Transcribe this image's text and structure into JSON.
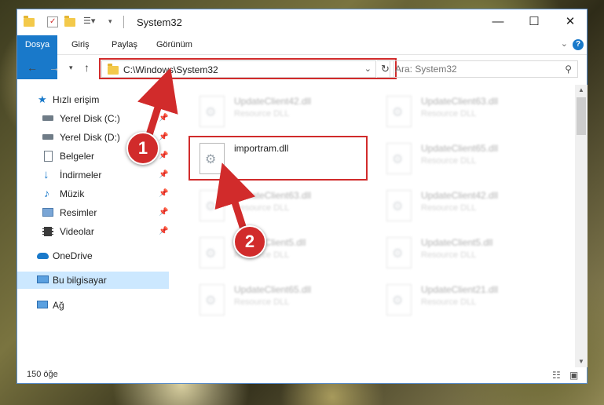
{
  "window": {
    "title": "System32",
    "controls": {
      "minimize": "—",
      "maximize": "☐",
      "close": "✕"
    }
  },
  "ribbon": {
    "tabs": [
      "Dosya",
      "Giriş",
      "Paylaş",
      "Görünüm"
    ],
    "help": "?"
  },
  "navigation": {
    "address": "C:\\Windows\\System32",
    "search_placeholder": "Ara: System32"
  },
  "sidebar": {
    "items": [
      {
        "label": "Hızlı erişim",
        "icon": "star-icon",
        "pinned": false
      },
      {
        "label": "Yerel Disk (C:)",
        "icon": "drive-icon",
        "pinned": true
      },
      {
        "label": "Yerel Disk (D:)",
        "icon": "drive-icon",
        "pinned": true
      },
      {
        "label": "Belgeler",
        "icon": "document-icon",
        "pinned": true
      },
      {
        "label": "İndirmeler",
        "icon": "download-icon",
        "pinned": true
      },
      {
        "label": "Müzik",
        "icon": "music-icon",
        "pinned": true
      },
      {
        "label": "Resimler",
        "icon": "pictures-icon",
        "pinned": true
      },
      {
        "label": "Videolar",
        "icon": "video-icon",
        "pinned": true
      },
      {
        "label": "OneDrive",
        "icon": "cloud-icon",
        "pinned": false
      },
      {
        "label": "Bu bilgisayar",
        "icon": "computer-icon",
        "pinned": false
      },
      {
        "label": "Ağ",
        "icon": "network-icon",
        "pinned": false
      }
    ]
  },
  "files": [
    {
      "name": "UpdateClient42.dll",
      "type": "Resource DLL"
    },
    {
      "name": "UpdateClient63.dll",
      "type": "Resource DLL"
    },
    {
      "name": "importram.dll",
      "type": ""
    },
    {
      "name": "UpdateClient65.dll",
      "type": "Resource DLL"
    },
    {
      "name": "UpdateClient63.dll",
      "type": "Resource DLL"
    },
    {
      "name": "UpdateClient42.dll",
      "type": "Resource DLL"
    },
    {
      "name": "UpdateClient5.dll",
      "type": "Resource DLL"
    },
    {
      "name": "UpdateClient5.dll",
      "type": "Resource DLL"
    },
    {
      "name": "UpdateClient65.dll",
      "type": "Resource DLL"
    },
    {
      "name": "UpdateClient21.dll",
      "type": "Resource DLL"
    }
  ],
  "status": {
    "count": "150 öğe"
  },
  "callouts": [
    "1",
    "2"
  ],
  "colors": {
    "accent": "#1979ca",
    "highlight": "#d12b2b",
    "selected": "#cce8ff"
  }
}
